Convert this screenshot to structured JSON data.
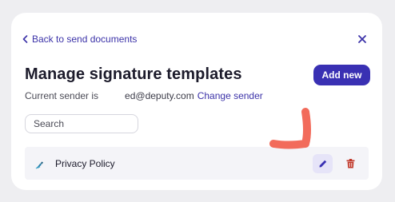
{
  "header": {
    "back_label": "Back to send documents",
    "title": "Manage signature templates",
    "add_label": "Add new"
  },
  "sender": {
    "label": "Current sender is",
    "email": "ed@deputy.com",
    "change_label": "Change sender"
  },
  "search": {
    "placeholder": "Search"
  },
  "templates": [
    {
      "name": "Privacy Policy",
      "icon": "signature-pen-icon"
    }
  ],
  "colors": {
    "accent": "#3930b3",
    "link": "#3b32a8",
    "delete": "#c0392b",
    "annotation": "#f26b5b",
    "row_bg": "#f4f4f8"
  }
}
